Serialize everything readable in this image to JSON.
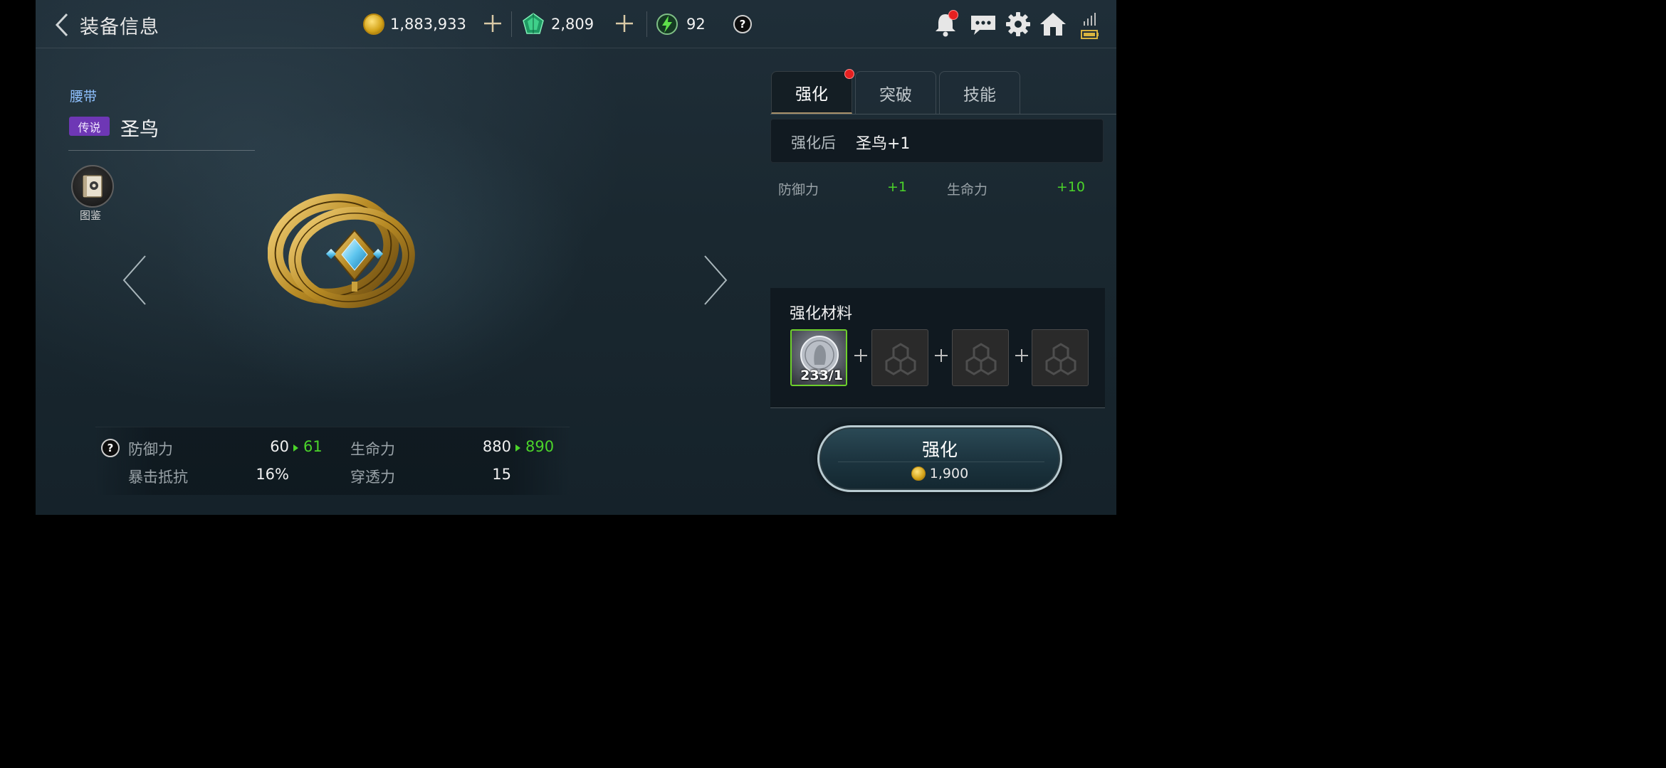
{
  "header": {
    "title": "装备信息",
    "currencies": [
      {
        "name": "gold",
        "value": "1,883,933"
      },
      {
        "name": "gem",
        "value": "2,809"
      },
      {
        "name": "energy",
        "value": "92"
      }
    ],
    "help_symbol": "?"
  },
  "item": {
    "type": "腰带",
    "rarity": "传说",
    "name": "圣鸟",
    "codex_label": "图鉴"
  },
  "stats": {
    "help_symbol": "?",
    "rows": [
      {
        "label": "防御力",
        "value": "60",
        "new_value": "61"
      },
      {
        "label": "生命力",
        "value": "880",
        "new_value": "890"
      },
      {
        "label": "暴击抵抗",
        "value": "16%"
      },
      {
        "label": "穿透力",
        "value": "15"
      }
    ]
  },
  "tabs": [
    {
      "label": "强化",
      "active": true
    },
    {
      "label": "突破",
      "active": false
    },
    {
      "label": "技能",
      "active": false
    }
  ],
  "enhance": {
    "after_label": "强化后",
    "after_name": "圣鸟+1",
    "bonuses": [
      {
        "label": "防御力",
        "value": "+1"
      },
      {
        "label": "生命力",
        "value": "+10"
      }
    ],
    "materials_title": "强化材料",
    "material_count": "233/1",
    "button_label": "强化",
    "button_cost": "1,900"
  },
  "colors": {
    "accent_green": "#4bd32a",
    "rarity_purple": "#6e37b5",
    "notification_red": "#e62020"
  }
}
